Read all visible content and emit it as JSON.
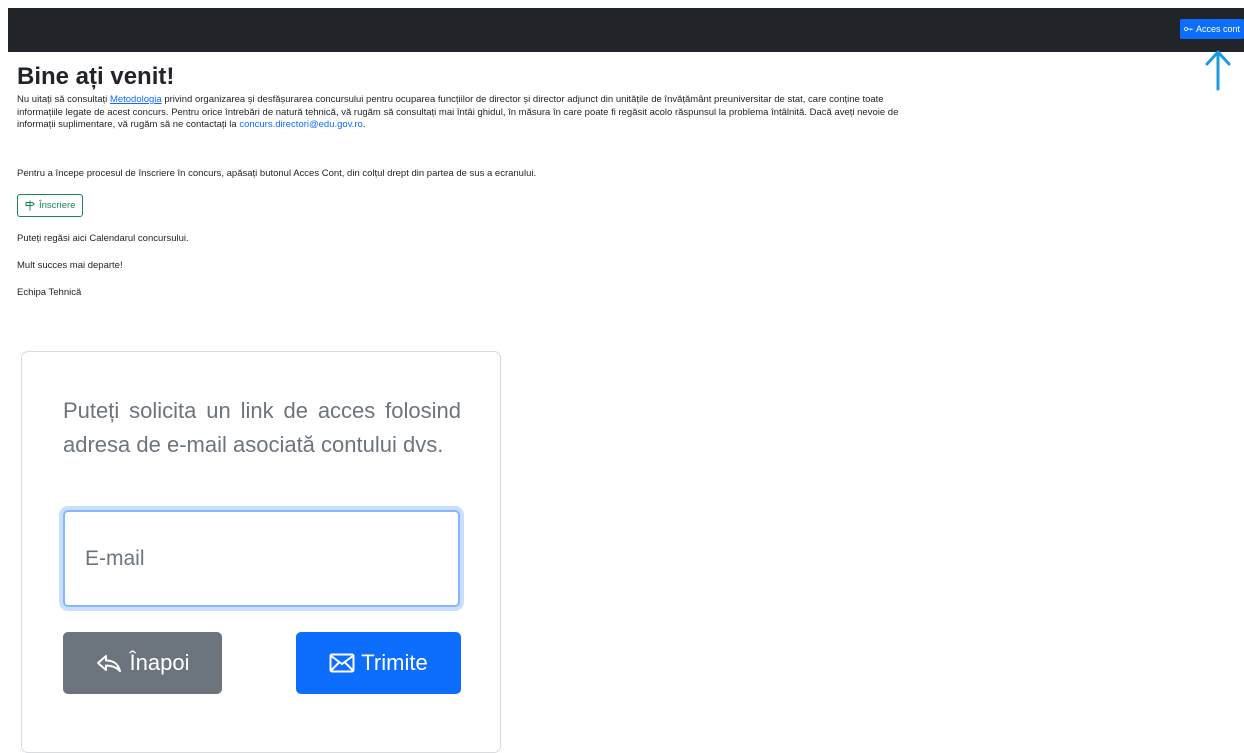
{
  "topbar": {
    "account_button": "Acces cont",
    "account_icon": "key-icon"
  },
  "annotation": {
    "arrow_icon": "arrow-up-icon",
    "color": "#1a9be0"
  },
  "main": {
    "title": "Bine ați venit!",
    "intro_before_link": "Nu uitați să consultați ",
    "metodologia_link": "Metodologia",
    "intro_after_link": " privind organizarea și desfășurarea concursului pentru ocuparea funcțiilor de director și director adjunct din unitățile de învățământ preuniversitar de stat, care conține toate informațiile legate de acest concurs. Pentru orice întrebări de natură tehnică, vă rugăm să consultați mai întâi ghidul, în măsura în care poate fi regăsit acolo răspunsul la problema întâlnită. Dacă aveți nevoie de informații suplimentare, vă rugăm să ne contactați la ",
    "contact_email": "concurs.directori@edu.gov.ro",
    "contact_suffix": ".",
    "start_text": "Pentru a începe procesul de înscriere în concurs, apăsați butonul Acces Cont, din colțul drept din partea de sus a ecranului.",
    "inscriere_button": "Înscriere",
    "inscriere_icon": "signpost-icon",
    "calendar_text": "Puteți regăsi aici Calendarul concursului.",
    "success_text": "Mult succes mai departe!",
    "team_text": "Echipa Tehnică"
  },
  "access_card": {
    "description": "Puteți solicita un link de acces folosind adresa de e-mail asociată contului dvs.",
    "email_placeholder": "E-mail",
    "email_value": "",
    "back_button": "Înapoi",
    "back_icon": "reply-icon",
    "send_button": "Trimite",
    "send_icon": "envelope-icon"
  },
  "colors": {
    "topbar": "#212529",
    "primary": "#0d6efd",
    "success": "#198754",
    "secondary": "#6c757d"
  }
}
